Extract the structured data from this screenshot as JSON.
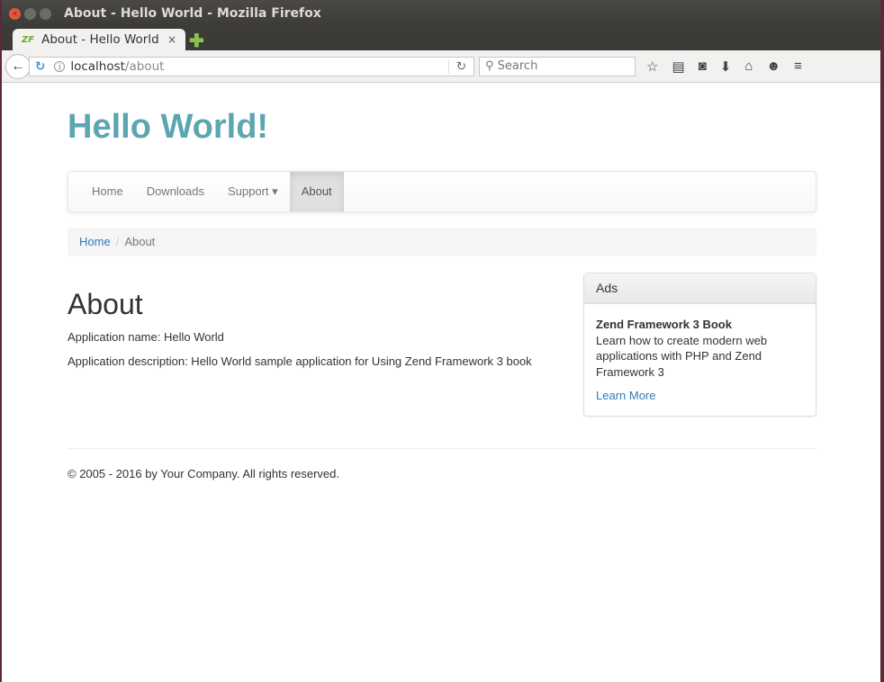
{
  "window": {
    "title": "About - Hello World - Mozilla Firefox",
    "close": "×",
    "minimize": "–",
    "maximize": "□"
  },
  "tab": {
    "favicon": "ZF",
    "label": "About - Hello World",
    "close": "×",
    "new_tab": "✚"
  },
  "toolbar": {
    "url_host": "localhost",
    "url_path": "/about",
    "search_placeholder": "Search"
  },
  "page": {
    "brand": "Hello World!",
    "nav": [
      "Home",
      "Downloads",
      "Support ▾",
      "About"
    ],
    "breadcrumb": {
      "home": "Home",
      "sep": "/",
      "current": "About"
    },
    "heading": "About",
    "app_name": "Application name: Hello World",
    "app_desc": "Application description: Hello World sample application for Using Zend Framework 3 book",
    "ads": {
      "title": "Ads",
      "book": "Zend Framework 3 Book",
      "text": "Learn how to create modern web applications with PHP and Zend Framework 3",
      "link": "Learn More"
    },
    "footer": "© 2005 - 2016 by Your Company. All rights reserved."
  }
}
